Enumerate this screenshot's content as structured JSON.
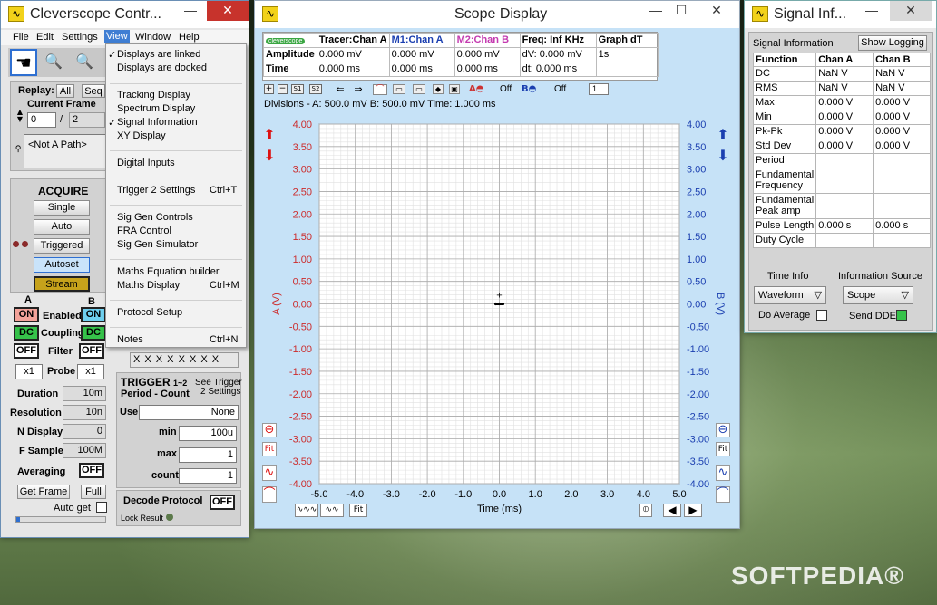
{
  "colors": {
    "chanA": "#cc2b2b",
    "chanB": "#1b3fb0",
    "accent": "#2e6fd1",
    "plotBg": "#c6e2f7"
  },
  "control": {
    "title": "Cleverscope Contr...",
    "menubar": [
      "File",
      "Edit",
      "Settings",
      "View",
      "Window",
      "Help"
    ],
    "replay_label": "Replay:",
    "all": "All",
    "seq": "Seq",
    "current_frame": "Current Frame",
    "frame_val": "0",
    "frame_sep": "/",
    "frame_total": "2",
    "path": "<Not A Path>",
    "acquire_title": "ACQUIRE",
    "single": "Single",
    "auto": "Auto",
    "triggered": "Triggered",
    "autoset": "Autoset",
    "stream": "Stream",
    "chA": "A",
    "chB": "B",
    "on": "ON",
    "enabled": "Enabled",
    "dc": "DC",
    "coupling": "Coupling",
    "off": "OFF",
    "filter": "Filter",
    "x1": "x1",
    "probe": "Probe",
    "duration": "Duration",
    "duration_val": "10m",
    "resolution": "Resolution",
    "resolution_val": "10n",
    "ndisplay": "N Display",
    "ndisplay_val": "0",
    "fsample": "F Sample",
    "fsample_val": "100M",
    "averaging": "Averaging",
    "averaging_val": "OFF",
    "get_frame": "Get Frame",
    "full": "Full",
    "auto_get": "Auto get",
    "trigger": "TRIGGER",
    "trig_sub": "1~2",
    "period_count": "Period - Count",
    "see_trigger": "See Trigger",
    "settings2": "2 Settings",
    "use": "Use",
    "use_val": "None",
    "min": "min",
    "min_val": "100u",
    "max": "max",
    "max_val": "1",
    "count": "count",
    "count_val": "1",
    "decode": "Decode Protocol",
    "decode_val": "OFF",
    "lock": "Lock Result",
    "xs": "X X X X X X X X"
  },
  "view_menu": {
    "items": [
      {
        "label": "Displays are linked",
        "check": "✓",
        "shortcut": ""
      },
      {
        "label": "Displays are docked",
        "check": "",
        "shortcut": ""
      },
      {
        "label": "Tracking Display",
        "check": "",
        "shortcut": ""
      },
      {
        "label": "Spectrum Display",
        "check": "",
        "shortcut": ""
      },
      {
        "label": "Signal Information",
        "check": "✓",
        "shortcut": ""
      },
      {
        "label": "XY Display",
        "check": "",
        "shortcut": ""
      },
      {
        "label": "Digital Inputs",
        "check": "",
        "shortcut": ""
      },
      {
        "label": "Trigger 2 Settings",
        "check": "",
        "shortcut": "Ctrl+T"
      },
      {
        "label": "Sig Gen Controls",
        "check": "",
        "shortcut": ""
      },
      {
        "label": "FRA Control",
        "check": "",
        "shortcut": ""
      },
      {
        "label": "Sig Gen Simulator",
        "check": "",
        "shortcut": ""
      },
      {
        "label": "Maths Equation builder",
        "check": "",
        "shortcut": ""
      },
      {
        "label": "Maths Display",
        "check": "",
        "shortcut": "Ctrl+M"
      },
      {
        "label": "Protocol Setup",
        "check": "",
        "shortcut": ""
      },
      {
        "label": "Notes",
        "check": "",
        "shortcut": "Ctrl+N"
      }
    ]
  },
  "scope": {
    "title": "Scope Display",
    "logo": "cleverscope",
    "hdr": [
      "Tracer:Chan A",
      "M1:Chan A",
      "M2:Chan B",
      "Freq: Inf KHz",
      "Graph dT"
    ],
    "amplitude": "Amplitude",
    "time": "Time",
    "amp_vals": [
      "0.000 mV",
      "0.000 mV",
      "0.000 mV",
      "dV: 0.000 mV",
      "1s"
    ],
    "time_vals": [
      "0.000 ms",
      "0.000 ms",
      "0.000 ms",
      "dt:  0.000 ms",
      ""
    ],
    "s1": "S1",
    "s2": "S2",
    "off": "Off",
    "off2": "Off",
    "spin": "1",
    "divisions": "Divisions -  A: 500.0 mV   B: 500.0 mV    Time: 1.000 ms",
    "axisA": "A (V)",
    "axisB": "B (V)",
    "xlabel": "Time (ms)",
    "fit": "Fit",
    "marker": "+"
  },
  "chart_data": {
    "type": "line",
    "title": "",
    "xlabel": "Time (ms)",
    "ylabel": "A (V)",
    "y2label": "B (V)",
    "xlim": [
      -5,
      5
    ],
    "ylim": [
      -4,
      4
    ],
    "x_ticks": [
      "-5.0",
      "-4.0",
      "-3.0",
      "-2.0",
      "-1.0",
      "0.0",
      "1.0",
      "2.0",
      "3.0",
      "4.0",
      "5.0"
    ],
    "y_ticks": [
      "4.00",
      "3.50",
      "3.00",
      "2.50",
      "2.00",
      "1.50",
      "1.00",
      "0.50",
      "0.00",
      "-0.50",
      "-1.00",
      "-1.50",
      "-2.00",
      "-2.50",
      "-3.00",
      "-3.50",
      "-4.00"
    ],
    "grid": true,
    "series": [
      {
        "x": [
          -0.1,
          0,
          0.1
        ],
        "y": [
          0,
          0,
          0
        ]
      }
    ]
  },
  "signal": {
    "title": "Signal Inf...",
    "header": "Signal Information",
    "show_logging": "Show Logging",
    "cols": [
      "Function",
      "Chan A",
      "Chan B"
    ],
    "rows": [
      [
        "DC",
        "NaN V",
        "NaN V"
      ],
      [
        "RMS",
        "NaN V",
        "NaN V"
      ],
      [
        "Max",
        "0.000 V",
        "0.000 V"
      ],
      [
        "Min",
        "0.000 V",
        "0.000 V"
      ],
      [
        "Pk-Pk",
        "0.000 V",
        "0.000 V"
      ],
      [
        "Std Dev",
        "0.000 V",
        "0.000 V"
      ],
      [
        "Period",
        "",
        ""
      ],
      [
        "Fundamental Frequency",
        "",
        ""
      ],
      [
        "Fundamental Peak amp",
        "",
        ""
      ],
      [
        "Pulse Length",
        "0.000 s",
        "0.000 s"
      ],
      [
        "Duty Cycle",
        "",
        ""
      ]
    ],
    "time_info": "Time Info",
    "info_source": "Information  Source",
    "waveform": "Waveform",
    "scope": "Scope",
    "do_average": "Do Average",
    "send_dde": "Send DDE"
  },
  "watermark": "SOFTPEDIA®"
}
